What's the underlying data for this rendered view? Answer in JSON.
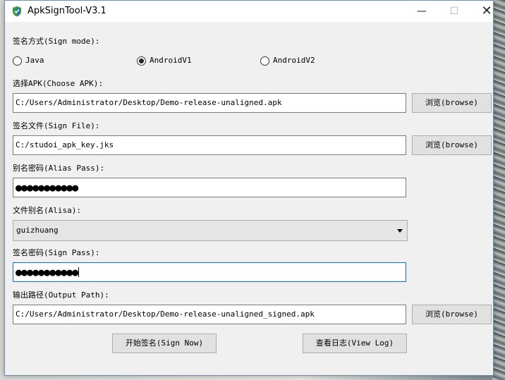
{
  "window": {
    "title": "ApkSignTool-V3.1",
    "min_symbol": "—",
    "max_symbol": "☐",
    "close_symbol": "✕",
    "icon": "shield-icon"
  },
  "sign_mode": {
    "label": "签名方式(Sign mode):",
    "options": [
      {
        "label": "Java",
        "selected": false
      },
      {
        "label": "AndroidV1",
        "selected": true
      },
      {
        "label": "AndroidV2",
        "selected": false
      }
    ]
  },
  "apk": {
    "label": "选择APK(Choose APK):",
    "value": "C:/Users/Administrator/Desktop/Demo-release-unaligned.apk",
    "browse_label": "浏览(browse)"
  },
  "sign_file": {
    "label": "签名文件(Sign File):",
    "value": "C:/studoi_apk_key.jks",
    "browse_label": "浏览(browse)"
  },
  "alias_pass": {
    "label": "别名密码(Alias Pass):",
    "masked_value": "●●●●●●●●●●●"
  },
  "alias": {
    "label": "文件别名(Alisa):",
    "selected": "guizhuang"
  },
  "sign_pass": {
    "label": "签名密码(Sign Pass):",
    "masked_value": "●●●●●●●●●●●"
  },
  "output": {
    "label": "输出路径(Output Path):",
    "value": "C:/Users/Administrator/Desktop/Demo-release-unaligned_signed.apk",
    "browse_label": "浏览(browse)"
  },
  "actions": {
    "sign_now": "开始签名(Sign Now)",
    "view_log": "查看日志(View Log)"
  }
}
